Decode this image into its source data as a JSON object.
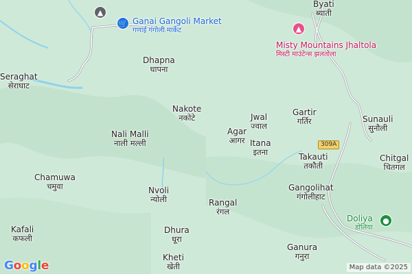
{
  "map": {
    "colors": {
      "terrain": "#cfe9d8",
      "river": "#8fd3ea",
      "road": "#ffffff",
      "road_casing": "#9aa0a6",
      "highway": "#f6cf65",
      "shopping_pin": "#1a73e8",
      "leisure_pin": "#e8508c",
      "park_pin": "#1e8e3e",
      "school_pin": "#5f6368",
      "poi_blue_text": "#1967d2",
      "poi_pink_text": "#c2185b",
      "poi_green_text": "#1e8e3e"
    },
    "places": [
      {
        "id": "byati",
        "en": "Byati",
        "hi": "ब्याती"
      },
      {
        "id": "dhapna",
        "en": "Dhapna",
        "hi": "धापना"
      },
      {
        "id": "seraghat",
        "en": "Seraghat",
        "hi": "सेराघाट"
      },
      {
        "id": "nakote",
        "en": "Nakote",
        "hi": "नकोटे"
      },
      {
        "id": "jwal",
        "en": "Jwal",
        "hi": "ज्वाल"
      },
      {
        "id": "gartir",
        "en": "Gartir",
        "hi": "गर्तिर"
      },
      {
        "id": "sunauli",
        "en": "Sunauli",
        "hi": "सुनौली"
      },
      {
        "id": "agar",
        "en": "Agar",
        "hi": "आगर"
      },
      {
        "id": "nali-malli",
        "en": "Nali Malli",
        "hi": "नाली मल्ली"
      },
      {
        "id": "itana",
        "en": "Itana",
        "hi": "इतना"
      },
      {
        "id": "takauti",
        "en": "Takauti",
        "hi": "तकौती"
      },
      {
        "id": "chitgal",
        "en": "Chitgal",
        "hi": "चितगल"
      },
      {
        "id": "chamuwa",
        "en": "Chamuwa",
        "hi": "चमुवा"
      },
      {
        "id": "nvoli",
        "en": "Nvoli",
        "hi": "न्योली"
      },
      {
        "id": "gangolihat",
        "en": "Gangolihat",
        "hi": "गंगोलीहाट"
      },
      {
        "id": "rangal",
        "en": "Rangal",
        "hi": "रंगल"
      },
      {
        "id": "kafali",
        "en": "Kafali",
        "hi": "कफली"
      },
      {
        "id": "dhura",
        "en": "Dhura",
        "hi": "धूरा"
      },
      {
        "id": "ganura",
        "en": "Ganura",
        "hi": "गनुरा"
      },
      {
        "id": "kheti",
        "en": "Kheti",
        "hi": "खेती"
      }
    ],
    "pois": {
      "ganai_market": {
        "en": "Ganai Gangoli Market",
        "hi": "गणाई गंगोली मार्केट",
        "icon": "shopping-cart-icon"
      },
      "misty_mountains": {
        "en": "Misty Mountains Jhaltola",
        "hi": "मिस्टी माउंटेन्स झलतोला",
        "icon": "hiking-icon"
      },
      "doliya": {
        "en": "Doliya",
        "hi": "डोलिया",
        "icon": "park-icon"
      },
      "school": {
        "icon": "school-icon"
      }
    },
    "road_shield": "309A",
    "branding": "Google",
    "attribution": "Map data ©2025"
  }
}
